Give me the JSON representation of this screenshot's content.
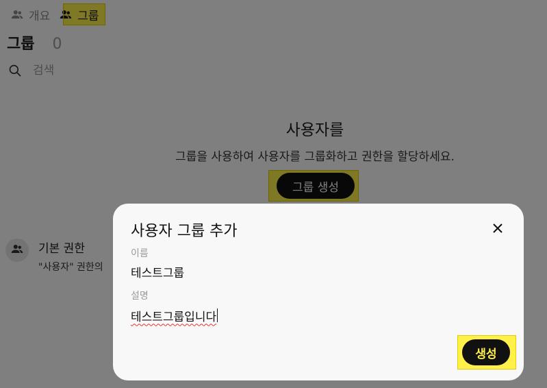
{
  "tabs": {
    "overview_label": "개요",
    "groups_label": "그룹"
  },
  "heading": {
    "title": "그룹",
    "count": "0"
  },
  "search": {
    "placeholder": "검색"
  },
  "empty_state": {
    "title": "사용자를",
    "description": "그룹을 사용하여 사용자를 그룹화하고 권한을 할당하세요.",
    "create_button": "그룹 생성"
  },
  "default_permission": {
    "title": "기본 권한",
    "subtitle": "\"사용자\" 권한의"
  },
  "modal": {
    "title": "사용자 그룹 추가",
    "name_label": "이름",
    "name_value": "테스트그룹",
    "description_label": "설명",
    "description_value": "테스트그룹입니다",
    "submit_button": "생성"
  },
  "colors": {
    "highlight": "#fff14a",
    "button_bg": "#111111",
    "overlay": "rgba(0,0,0,0.5)",
    "modal_bg": "#f8f8f8"
  },
  "icons": {
    "overview_tab": "users-icon",
    "groups_tab": "users-icon",
    "search": "search-icon",
    "default_permission": "users-icon",
    "close": "close-icon"
  }
}
